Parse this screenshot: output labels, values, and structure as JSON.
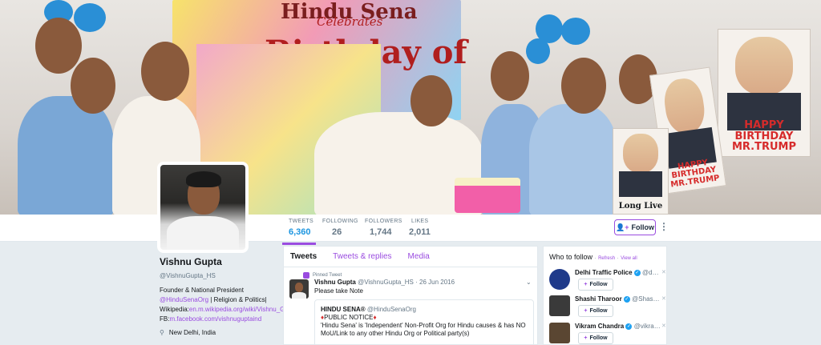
{
  "header": {
    "banner_line1": "Hindu Sena",
    "banner_line2": "Celebrates",
    "banner_line3": "Birthday of",
    "poster_right": "HAPPY BIRTHDAY MR.TRUMP",
    "poster_mid": "HAPPY BIRTHDAY MR.TRUMP",
    "poster_small": "Long Live"
  },
  "nav": {
    "stats": [
      {
        "label": "TWEETS",
        "value": "6,360"
      },
      {
        "label": "FOLLOWING",
        "value": "26"
      },
      {
        "label": "FOLLOWERS",
        "value": "1,744"
      },
      {
        "label": "LIKES",
        "value": "2,011"
      }
    ],
    "follow_label": "Follow",
    "more_icon": "⋮"
  },
  "profile": {
    "name": "Vishnu Gupta",
    "handle": "@VishnuGupta_HS",
    "bio_line1": "Founder & National President",
    "bio_mention": "@HinduSenaOrg",
    "bio_after_mention": " | Religion & Politics|",
    "bio_wiki_prefix": "Wikipedia:",
    "bio_wiki_link": "en.m.wikipedia.org/wiki/Vishnu_Gu…",
    "bio_fb_prefix": "FB:",
    "bio_fb_link": "m.facebook.com/vishnuguptaind",
    "location": "New Delhi, India"
  },
  "timeline": {
    "tabs": [
      "Tweets",
      "Tweets & replies",
      "Media"
    ],
    "pinned_label": "Pinned Tweet",
    "tweet": {
      "name": "Vishnu Gupta",
      "handle": "@VishnuGupta_HS",
      "date": "· 26 Jun 2016",
      "text": "Please take Note"
    },
    "quote": {
      "name": "HINDU SENA®",
      "handle": "@HinduSenaOrg",
      "notice": "PUBLIC NOTICE",
      "body": "'Hindu Sena' is 'Independent' Non-Profit Org for Hindu causes & has NO MoU/Link to any other Hindu Org or Political party(s)"
    }
  },
  "who_to_follow": {
    "title": "Who to follow",
    "refresh": "Refresh",
    "view_all": "View all",
    "recs": [
      {
        "name": "Delhi Traffic Police",
        "handle": "@d…",
        "follow": "Follow",
        "avatar_color": "#1f3a8a"
      },
      {
        "name": "Shashi Tharoor",
        "handle": "@Shas…",
        "follow": "Follow",
        "avatar_color": "#3a3a3a"
      },
      {
        "name": "Vikram Chandra",
        "handle": "@vikra…",
        "follow": "Follow",
        "avatar_color": "#5a4632"
      }
    ]
  },
  "colors": {
    "accent": "#9a4ce0",
    "link_blue": "#1b95e0",
    "background": "#e6ecf0"
  }
}
